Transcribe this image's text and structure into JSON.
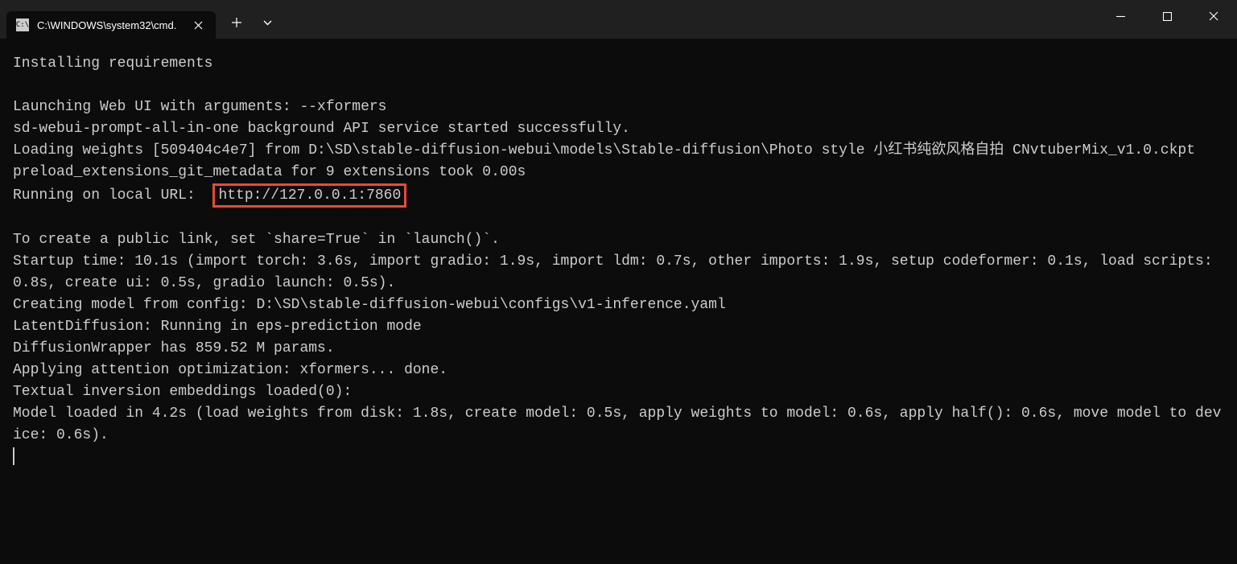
{
  "titlebar": {
    "tab": {
      "title": "C:\\WINDOWS\\system32\\cmd.",
      "icon_label": "C:\\"
    }
  },
  "terminal": {
    "lines": {
      "l0": "Installing requirements",
      "l1": "",
      "l2": "Launching Web UI with arguments: --xformers",
      "l3": "sd-webui-prompt-all-in-one background API service started successfully.",
      "l4": "Loading weights [509404c4e7] from D:\\SD\\stable-diffusion-webui\\models\\Stable-diffusion\\Photo style 小红书纯欲风格自拍 CNvtuberMix_v1.0.ckpt",
      "l5": "preload_extensions_git_metadata for 9 extensions took 0.00s",
      "l6_prefix": "Running on local URL:  ",
      "l6_highlight": "http://127.0.0.1:7860",
      "l7": "",
      "l8": "To create a public link, set `share=True` in `launch()`.",
      "l9": "Startup time: 10.1s (import torch: 3.6s, import gradio: 1.9s, import ldm: 0.7s, other imports: 1.9s, setup codeformer: 0.1s, load scripts: 0.8s, create ui: 0.5s, gradio launch: 0.5s).",
      "l10": "Creating model from config: D:\\SD\\stable-diffusion-webui\\configs\\v1-inference.yaml",
      "l11": "LatentDiffusion: Running in eps-prediction mode",
      "l12": "DiffusionWrapper has 859.52 M params.",
      "l13": "Applying attention optimization: xformers... done.",
      "l14": "Textual inversion embeddings loaded(0):",
      "l15": "Model loaded in 4.2s (load weights from disk: 1.8s, create model: 0.5s, apply weights to model: 0.6s, apply half(): 0.6s, move model to device: 0.6s)."
    }
  }
}
